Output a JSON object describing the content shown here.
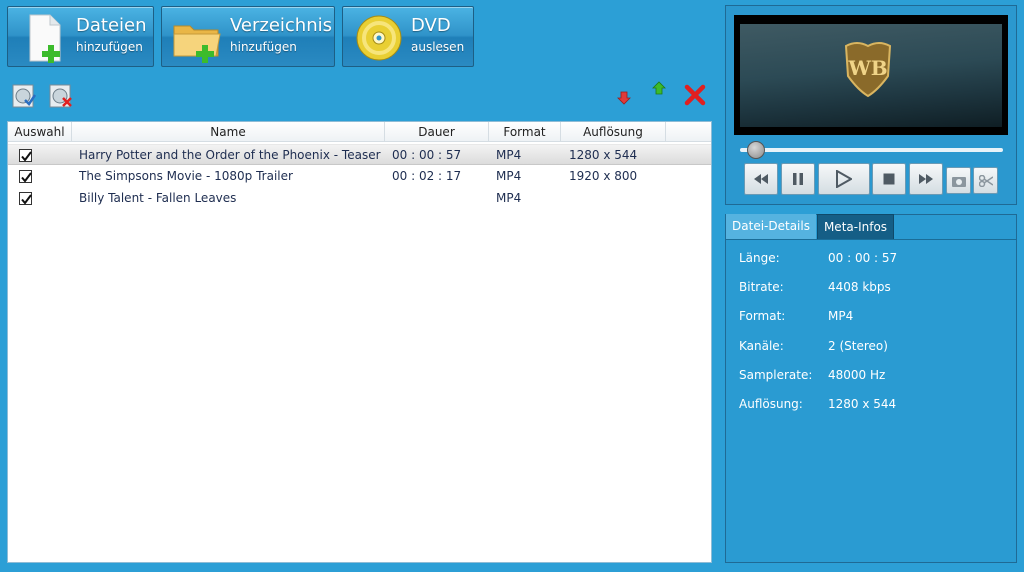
{
  "toolbar": {
    "files": {
      "title": "Dateien",
      "subtitle": "hinzufügen"
    },
    "directory": {
      "title": "Verzeichnis",
      "subtitle": "hinzufügen"
    },
    "dvd": {
      "title": "DVD",
      "subtitle": "auslesen"
    }
  },
  "list": {
    "columns": [
      "Auswahl",
      "Name",
      "Dauer",
      "Format",
      "Auflösung"
    ],
    "rows": [
      {
        "checked": true,
        "name": "Harry Potter and the Order of the Phoenix - Teaser",
        "duration": "00 : 00 : 57",
        "format": "MP4",
        "resolution": "1280 x 544",
        "selected": true
      },
      {
        "checked": true,
        "name": "The Simpsons Movie - 1080p Trailer",
        "duration": "00 : 02 : 17",
        "format": "MP4",
        "resolution": "1920 x 800",
        "selected": false
      },
      {
        "checked": true,
        "name": "Billy Talent - Fallen Leaves",
        "duration": "",
        "format": "MP4",
        "resolution": "",
        "selected": false
      }
    ]
  },
  "player": {
    "seek_position": 0.06
  },
  "details": {
    "tabs": [
      "Datei-Details",
      "Meta-Infos"
    ],
    "fields": [
      {
        "label": "Länge:",
        "value": "00 : 00 : 57"
      },
      {
        "label": "Bitrate:",
        "value": "4408 kbps"
      },
      {
        "label": "Format:",
        "value": "MP4"
      },
      {
        "label": "Kanäle:",
        "value": "2 (Stereo)"
      },
      {
        "label": "Samplerate:",
        "value": "48000 Hz"
      },
      {
        "label": "Auflösung:",
        "value": "1280 x 544"
      }
    ]
  },
  "colors": {
    "background": "#2c9fd6",
    "accent_green": "#3cbb2c",
    "delete_red": "#e02020"
  }
}
